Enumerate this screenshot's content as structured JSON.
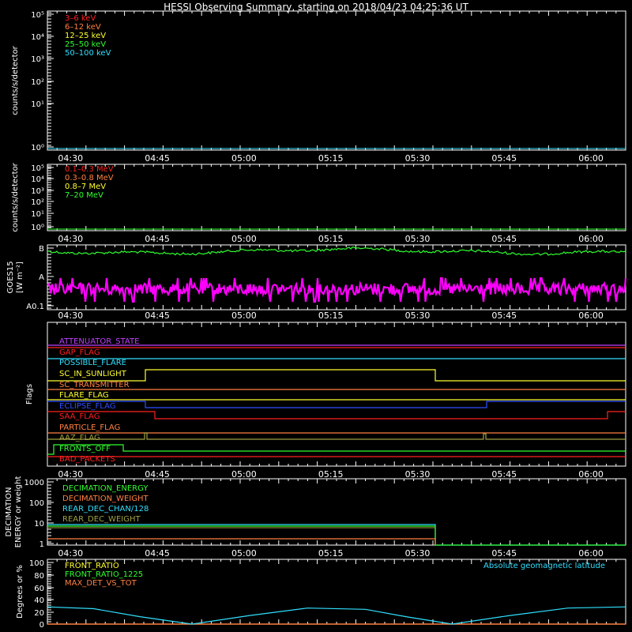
{
  "title": "HESSI Observing Summary, starting on 2018/04/23 04:25:36 UT",
  "time_ticks": [
    "04:30",
    "04:45",
    "05:00",
    "05:15",
    "05:30",
    "05:45",
    "06:00"
  ],
  "chart_data": [
    {
      "id": "low-energy-rates",
      "type": "line",
      "ylabel": "counts/s/detector",
      "yscale": "log",
      "ylim": [
        1,
        100000
      ],
      "tick_labels": [
        "10⁵",
        "10⁴",
        "10³",
        "10²",
        "10¹",
        "10⁰"
      ],
      "legend": [
        {
          "text": "3–6 keV",
          "color": "#ff2020"
        },
        {
          "text": "6–12 keV",
          "color": "#ff8040"
        },
        {
          "text": "12–25 keV",
          "color": "#ffff30"
        },
        {
          "text": "25–50 keV",
          "color": "#30ff30"
        },
        {
          "text": "50–100 keV",
          "color": "#30e0ff"
        }
      ],
      "series": [
        {
          "name": "50–100 keV",
          "color": "#30e0ff",
          "x": [
            0,
            100
          ],
          "y": [
            1,
            1
          ]
        }
      ]
    },
    {
      "id": "high-energy-rates",
      "type": "line",
      "ylabel": "counts/s/detector",
      "yscale": "log",
      "ylim": [
        1,
        100000
      ],
      "tick_labels": [
        "10⁵",
        "10⁴",
        "10³",
        "10²",
        "10¹",
        "10⁰"
      ],
      "legend": [
        {
          "text": "0.1–0.3 MeV",
          "color": "#ff2020"
        },
        {
          "text": "0.3–0.8 MeV",
          "color": "#ff8040"
        },
        {
          "text": "0.8–7 MeV",
          "color": "#ffff30"
        },
        {
          "text": "7–20 MeV",
          "color": "#30ff30"
        }
      ],
      "series": [
        {
          "name": "7–20 MeV",
          "color": "#30ff30",
          "x": [
            0,
            100
          ],
          "y": [
            1,
            1
          ]
        }
      ]
    },
    {
      "id": "goes",
      "type": "line",
      "ylabel": "GOES15",
      "ylabel2": "[W m⁻²]",
      "tick_labels": [
        "B",
        "A",
        "A0.1"
      ],
      "series": [
        {
          "name": "long channel",
          "color": "#30ff30",
          "level": 0.92
        },
        {
          "name": "short channel",
          "color": "#ff00ff",
          "level": 0.3
        }
      ]
    },
    {
      "id": "flags",
      "type": "line",
      "ylabel": "Flags",
      "rows": [
        {
          "name": "ATTENUATOR_STATE",
          "color": "#c040ff"
        },
        {
          "name": "GAP_FLAG",
          "color": "#ff2020"
        },
        {
          "name": "POSSIBLE_FLARE",
          "color": "#30e0ff"
        },
        {
          "name": "SC_IN_SUNLIGHT",
          "color": "#ffff30"
        },
        {
          "name": "SC_TRANSMITTER",
          "color": "#ff8040"
        },
        {
          "name": "FLARE_FLAG",
          "color": "#ffff30"
        },
        {
          "name": "ECLIPSE_FLAG",
          "color": "#3050ff"
        },
        {
          "name": "SAA_FLAG",
          "color": "#ff2020"
        },
        {
          "name": "PARTICLE_FLAG",
          "color": "#ff8040"
        },
        {
          "name": "AAZ_FLAG",
          "color": "#a0a040"
        },
        {
          "name": "FRONTS_OFF",
          "color": "#30ff30"
        },
        {
          "name": "BAD_PACKETS",
          "color": "#ff2020"
        }
      ]
    },
    {
      "id": "decimation",
      "type": "line",
      "ylabel": "DECIMATION",
      "ylabel2": "ENERGY or weight",
      "yscale": "log",
      "ylim": [
        1,
        1000
      ],
      "tick_labels": [
        "1000",
        "100",
        "10",
        "1"
      ],
      "legend": [
        {
          "text": "DECIMATION_ENERGY",
          "color": "#30ff30"
        },
        {
          "text": "DECIMATION_WEIGHT",
          "color": "#ff8040"
        },
        {
          "text": "REAR_DEC_CHAN/128",
          "color": "#30e0ff"
        },
        {
          "text": "REAR_DEC_WEIGHT",
          "color": "#a0a040"
        }
      ]
    },
    {
      "id": "ratios",
      "type": "line",
      "ylabel": "Degrees or %",
      "ylim": [
        0,
        100
      ],
      "tick_labels": [
        "100",
        "80",
        "60",
        "40",
        "20",
        "0"
      ],
      "legend": [
        {
          "text": "FRONT_RATIO",
          "color": "#ffff30"
        },
        {
          "text": "FRONT_RATIO_1225",
          "color": "#30ff30"
        },
        {
          "text": "MAX_DET_VS_TOT",
          "color": "#ff8040"
        }
      ],
      "legend_right": {
        "text": "Absolute geomagnetic latitude",
        "color": "#30e0ff"
      },
      "geomag_latitude": {
        "minutes": [
          0,
          8,
          16,
          25,
          35,
          45,
          55,
          62,
          70,
          80,
          90,
          100
        ],
        "degrees": [
          28,
          25,
          12,
          0,
          14,
          26,
          24,
          12,
          0,
          14,
          26,
          28
        ]
      }
    }
  ]
}
